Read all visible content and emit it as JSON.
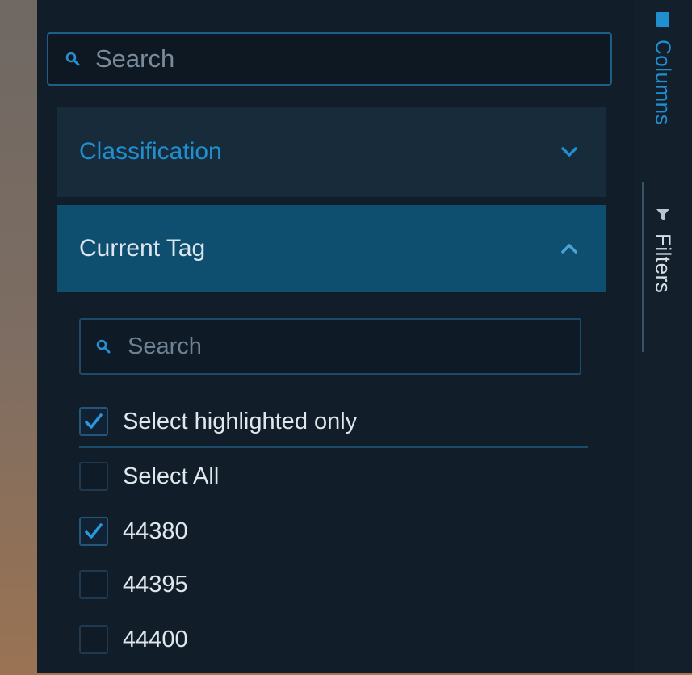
{
  "search": {
    "placeholder": "Search"
  },
  "groups": [
    {
      "label": "Classification",
      "expanded": false,
      "color": "#1f8fd0"
    },
    {
      "label": "Current Tag",
      "expanded": true,
      "color": "#0e4e6f"
    }
  ],
  "filter": {
    "search_placeholder": "Search",
    "select_highlighted": {
      "label": "Select highlighted only",
      "checked": true
    },
    "select_all": {
      "label": "Select All",
      "checked": false
    },
    "values": [
      {
        "label": "44380",
        "checked": true
      },
      {
        "label": "44395",
        "checked": false
      },
      {
        "label": "44400",
        "checked": false
      }
    ]
  },
  "side_tabs": {
    "columns": {
      "label": "Columns",
      "icon": "columns-icon",
      "active": true
    },
    "filters": {
      "label": "Filters",
      "icon": "filter-icon",
      "active": false
    }
  },
  "colors": {
    "accent": "#1f8fd0",
    "panel_bg": "#111d28",
    "header_active_bg": "#0e4e6f"
  }
}
